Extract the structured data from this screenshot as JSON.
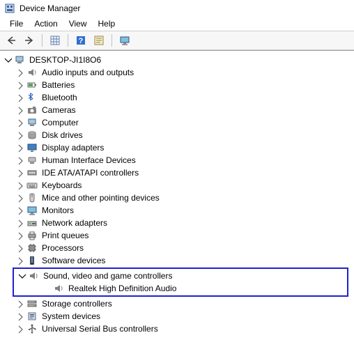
{
  "window": {
    "title": "Device Manager"
  },
  "menu": {
    "file": "File",
    "action": "Action",
    "view": "View",
    "help": "Help"
  },
  "root": {
    "name": "DESKTOP-JI1I8O6"
  },
  "categories": [
    {
      "label": "Audio inputs and outputs",
      "icon": "speaker",
      "expanded": false
    },
    {
      "label": "Batteries",
      "icon": "battery",
      "expanded": false
    },
    {
      "label": "Bluetooth",
      "icon": "bluetooth",
      "expanded": false
    },
    {
      "label": "Cameras",
      "icon": "camera",
      "expanded": false
    },
    {
      "label": "Computer",
      "icon": "computer",
      "expanded": false
    },
    {
      "label": "Disk drives",
      "icon": "disk",
      "expanded": false
    },
    {
      "label": "Display adapters",
      "icon": "display",
      "expanded": false
    },
    {
      "label": "Human Interface Devices",
      "icon": "hid",
      "expanded": false
    },
    {
      "label": "IDE ATA/ATAPI controllers",
      "icon": "ide",
      "expanded": false
    },
    {
      "label": "Keyboards",
      "icon": "keyboard",
      "expanded": false
    },
    {
      "label": "Mice and other pointing devices",
      "icon": "mouse",
      "expanded": false
    },
    {
      "label": "Monitors",
      "icon": "monitor",
      "expanded": false
    },
    {
      "label": "Network adapters",
      "icon": "network",
      "expanded": false
    },
    {
      "label": "Print queues",
      "icon": "printer",
      "expanded": false
    },
    {
      "label": "Processors",
      "icon": "cpu",
      "expanded": false
    },
    {
      "label": "Software devices",
      "icon": "software",
      "expanded": false
    },
    {
      "label": "Sound, video and game controllers",
      "icon": "speaker",
      "expanded": true,
      "children": [
        {
          "label": "Realtek High Definition Audio",
          "icon": "speaker"
        }
      ],
      "highlighted": true
    },
    {
      "label": "Storage controllers",
      "icon": "storage",
      "expanded": false
    },
    {
      "label": "System devices",
      "icon": "system",
      "expanded": false
    },
    {
      "label": "Universal Serial Bus controllers",
      "icon": "usb",
      "expanded": false
    }
  ]
}
